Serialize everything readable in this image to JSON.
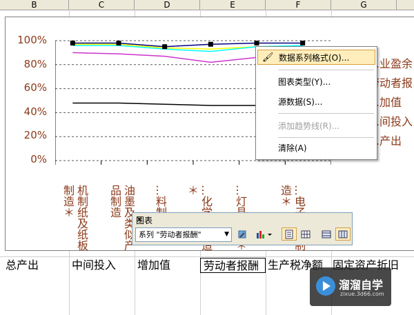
{
  "columns": [
    "B",
    "C",
    "D",
    "E",
    "F",
    "G"
  ],
  "chart": {
    "y_ticks": [
      "100%",
      "80%",
      "60%",
      "40%",
      "20%",
      "0%"
    ],
    "categories": [
      "机制纸及纸板制造＊",
      "油墨及类似产品制造",
      "…料制造",
      "…化学品…造＊",
      "…灯具制…＊",
      "…电子设…制造＊"
    ],
    "legend": [
      "…业盈余",
      "劳动者报…",
      "…加值",
      "…间投入",
      "…产出"
    ]
  },
  "chart_data": {
    "type": "line",
    "categories": [
      "机制纸及纸板制造＊",
      "油墨及类似产品制造",
      "…料制造",
      "…化学品…造＊",
      "…灯具制…＊",
      "…电子设…制造＊"
    ],
    "ylim": [
      0,
      1
    ],
    "grid": true,
    "legend_position": "right",
    "series": [
      {
        "name": "…产出",
        "color": "#000080",
        "values": [
          0.98,
          0.98,
          0.95,
          0.97,
          0.98,
          0.98
        ]
      },
      {
        "name": "…间投入",
        "color": "#ffff00",
        "values": [
          0.97,
          0.97,
          0.94,
          0.93,
          0.95,
          0.95
        ]
      },
      {
        "name": "…加值",
        "color": "#00ffff",
        "values": [
          0.96,
          0.96,
          0.93,
          0.91,
          0.95,
          0.96
        ]
      },
      {
        "name": "劳动者报…",
        "color": "#cc33cc",
        "values": [
          0.9,
          0.89,
          0.87,
          0.82,
          0.86,
          0.86
        ]
      },
      {
        "name": "…业盈余",
        "color": "#000000",
        "values": [
          0.48,
          0.48,
          0.47,
          0.46,
          0.46,
          0.46
        ]
      }
    ]
  },
  "context_menu": {
    "items": [
      {
        "label": "数据系列格式(O)...",
        "icon": "format-series-icon",
        "selected": true,
        "disabled": false
      },
      {
        "label": "图表类型(Y)...",
        "icon": "",
        "selected": false,
        "disabled": false
      },
      {
        "label": "源数据(S)...",
        "icon": "",
        "selected": false,
        "disabled": false
      },
      {
        "label": "添加趋势线(R)...",
        "icon": "",
        "selected": false,
        "disabled": true
      },
      {
        "label": "清除(A)",
        "icon": "",
        "selected": false,
        "disabled": false
      }
    ]
  },
  "toolbar": {
    "title": "图表",
    "close": "×",
    "series_select": "系列 \"劳动者报酬\"",
    "dropdown_arrow": "▼"
  },
  "bottom_row": [
    "总产出",
    "中间投入",
    "增加值",
    "劳动者报酬",
    "生产税净额",
    "固定资产折旧"
  ],
  "watermark": {
    "brand": "溜溜自学",
    "url": "zixue.3d66.com"
  }
}
